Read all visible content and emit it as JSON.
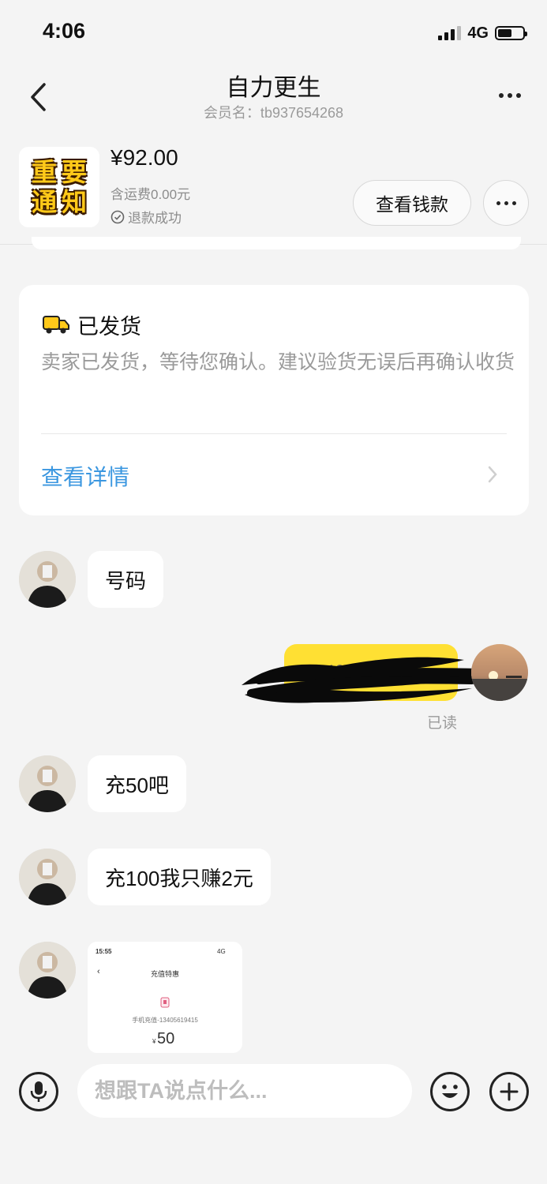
{
  "status_bar": {
    "time": "4:06",
    "network": "4G"
  },
  "header": {
    "title": "自力更生",
    "subtitle": "会员名：tb937654268"
  },
  "order": {
    "thumbnail_text": [
      "重",
      "要",
      "通",
      "知"
    ],
    "price": "¥92.00",
    "shipping": "含运费0.00元",
    "refund_status": "退款成功",
    "view_money_label": "查看钱款"
  },
  "shipment": {
    "title": "已发货",
    "description": "卖家已发货，等待您确认。建议验货无误后再确认收货",
    "detail_link": "查看详情"
  },
  "messages": [
    {
      "side": "left",
      "type": "text",
      "text": "号码"
    },
    {
      "side": "right",
      "type": "text",
      "text": "13405619415",
      "read_label": "已读"
    },
    {
      "side": "left",
      "type": "text",
      "text": "充50吧"
    },
    {
      "side": "left",
      "type": "text",
      "text": "充100我只赚2元"
    },
    {
      "side": "left",
      "type": "image",
      "screenshot": {
        "time": "15:55",
        "network": "4G",
        "title": "充值特惠",
        "phone_line": "手机充值-13405619415",
        "amount": "50",
        "currency": "¥"
      }
    }
  ],
  "input": {
    "placeholder": "想跟TA说点什么..."
  },
  "colors": {
    "accent_yellow": "#ffe033",
    "link_blue": "#3b97e0",
    "background": "#f4f4f4"
  }
}
